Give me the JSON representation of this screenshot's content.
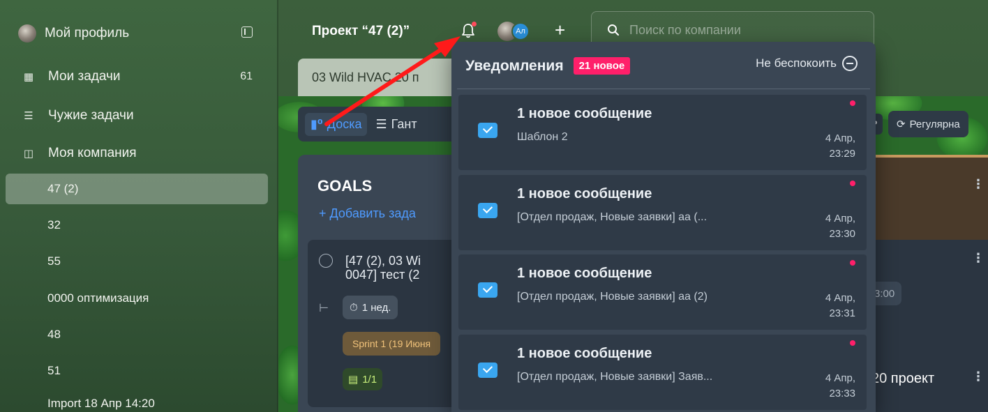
{
  "sidebar": {
    "profile_label": "Мой профиль",
    "items": [
      {
        "label": "Мои задачи",
        "count": "61",
        "icon": "id-card-icon"
      },
      {
        "label": "Чужие задачи",
        "icon": "list-icon"
      },
      {
        "label": "Моя компания",
        "icon": "briefcase-icon"
      }
    ],
    "projects": [
      "47 (2)",
      "32",
      "55",
      "0000 оптимизация",
      "48",
      "51",
      "Import 18 Апр 14:20"
    ]
  },
  "header": {
    "project_title": "Проект “47 (2)”",
    "member_initials": "Ал",
    "search_placeholder": "Поиск по компании"
  },
  "tab": {
    "label": "03 Wild HVAC,20 п"
  },
  "views": {
    "board": "Доска",
    "gantt": "Гант"
  },
  "right_tools": {
    "help": "?",
    "regular": "Регулярна"
  },
  "column": {
    "title": "GOALS",
    "add_task": "+ Добавить зада"
  },
  "card": {
    "line1": "[47 (2), 03 Wi",
    "line2": "0047] тест (2",
    "estimate": "1 нед.",
    "sprint": "Sprint 1 (19 Июня",
    "comments": "1/1"
  },
  "right_board": {
    "time": "3:00",
    "project_text": "20 проект"
  },
  "notifications": {
    "title": "Уведомления",
    "badge": "21 новое",
    "dnd_label": "Не беспокоить",
    "items": [
      {
        "title": "1 новое сообщение",
        "subtitle": "Шаблон 2",
        "date": "4 Апр,",
        "time": "23:29"
      },
      {
        "title": "1 новое сообщение",
        "subtitle": "[Отдел продаж, Новые заявки] аа (...",
        "date": "4 Апр,",
        "time": "23:30"
      },
      {
        "title": "1 новое сообщение",
        "subtitle": "[Отдел продаж, Новые заявки] аа (2)",
        "date": "4 Апр,",
        "time": "23:31"
      },
      {
        "title": "1 новое сообщение",
        "subtitle": "[Отдел продаж, Новые заявки] Заяв...",
        "date": "4 Апр,",
        "time": "23:33"
      }
    ]
  },
  "colors": {
    "accent_blue": "#4f9bff",
    "badge_pink": "#ff1f6a",
    "panel_bg": "#3a4654",
    "annotation_red": "#ff1a1a"
  }
}
